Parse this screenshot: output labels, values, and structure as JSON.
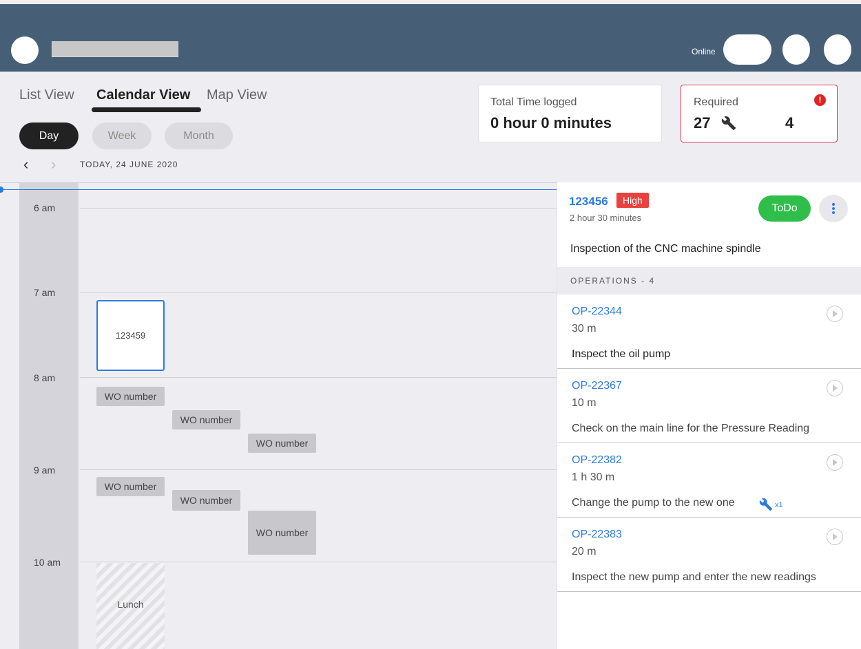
{
  "header": {
    "status": "Online"
  },
  "views": {
    "tabs": [
      "List View",
      "Calendar View",
      "Map View"
    ],
    "active": "Calendar View"
  },
  "range": {
    "options": [
      "Day",
      "Week",
      "Month"
    ],
    "active": "Day"
  },
  "date_label": "TODAY, 24 JUNE 2020",
  "stats": {
    "time_logged_label": "Total Time logged",
    "time_logged_value": "0 hour 0 minutes",
    "required_label": "Required",
    "required_tools": "27",
    "required_count": "4",
    "alert_symbol": "!"
  },
  "calendar": {
    "hours": [
      "6 am",
      "7 am",
      "8 am",
      "9 am",
      "10 am"
    ],
    "selected_wo": "123459",
    "wo_label": "WO number",
    "lunch_label": "Lunch"
  },
  "detail": {
    "id": "123456",
    "priority": "High",
    "duration": "2 hour  30 minutes",
    "status": "ToDo",
    "description": "Inspection of the CNC machine spindle",
    "operations_header": "OPERATIONS - 4",
    "operations": [
      {
        "code": "OP-22344",
        "duration": "30 m",
        "text": "Inspect the oil pump"
      },
      {
        "code": "OP-22367",
        "duration": "10 m",
        "text": "Check on the main line for the Pressure Reading"
      },
      {
        "code": "OP-22382",
        "duration": "1 h 30 m",
        "text": "Change the pump to the new one",
        "tool_qty": "x1"
      },
      {
        "code": "OP-22383",
        "duration": "20 m",
        "text": "Inspect the new pump and enter the new readings"
      }
    ]
  },
  "colors": {
    "header_bg": "#475f76",
    "accent_blue": "#2c7be5",
    "priority_red": "#e8413e",
    "status_green": "#2fbe4a",
    "alert_red": "#e02424"
  },
  "icons": [
    "avatar",
    "wrench-icon",
    "alert-icon",
    "more-vertical-icon",
    "play-circle-icon",
    "chevron-left-icon",
    "chevron-right-icon"
  ]
}
